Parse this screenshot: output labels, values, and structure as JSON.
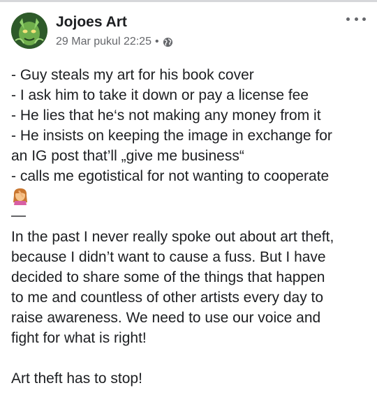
{
  "post": {
    "author": "Jojoes Art",
    "timestamp": "29 Mar pukul 22:25",
    "separator": "•",
    "privacy_icon": "globe-icon",
    "more_icon": "more-options-icon",
    "list_lines": [
      "- Guy steals my art for his book cover",
      "- I ask him to take it down or pay a license fee",
      "- He lies that he‘s not making any money from it",
      "- He insists on keeping the image in exchange for",
      "an IG post that’ll „give me business“",
      "- calls me egotistical for not wanting to cooperate"
    ],
    "emoji": "woman-facepalming-emoji",
    "dash": "—",
    "paragraph_lines": [
      "In the past I never really spoke out about art theft,",
      "because I didn’t want to cause a fuss. But I have",
      "decided to share some of the things that happen",
      "to me and countless of other artists every day to",
      "raise awareness. We need to use our voice and",
      "fight for what is right!"
    ],
    "closing": "Art theft has to stop!"
  }
}
